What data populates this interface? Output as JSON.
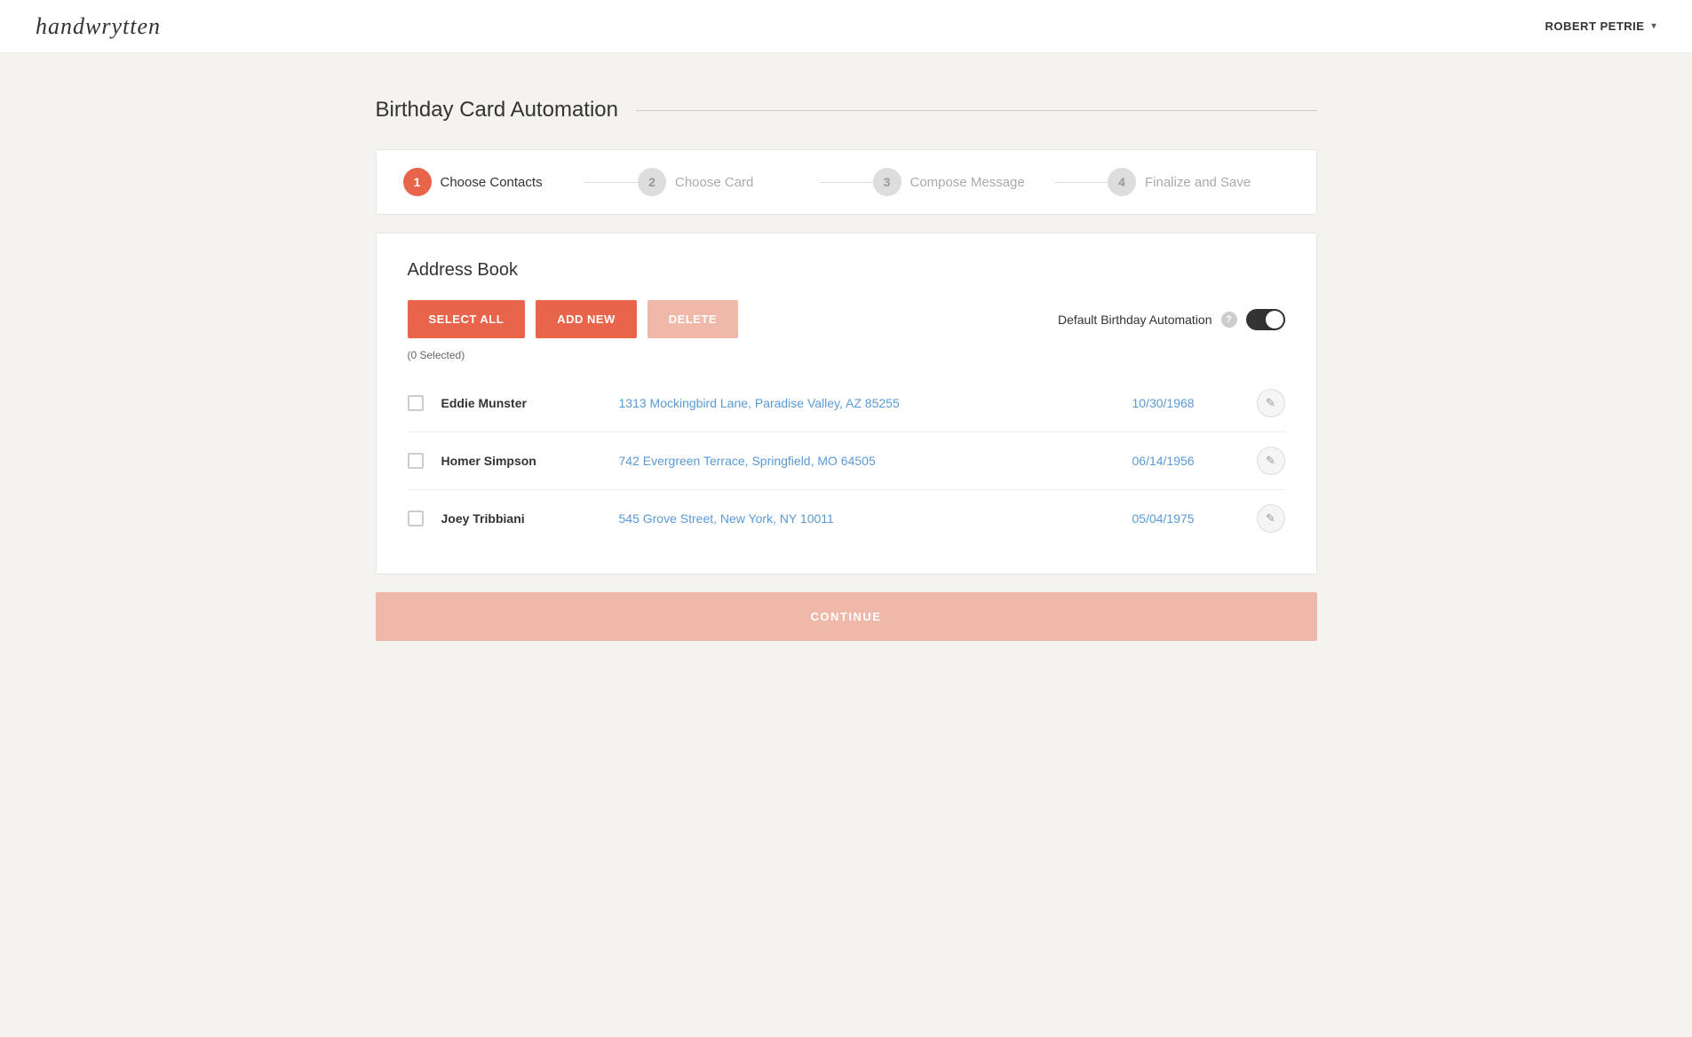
{
  "header": {
    "logo": "handwrytten",
    "user_name": "ROBERT PETRIE",
    "chevron": "▾"
  },
  "page": {
    "title": "Birthday Card Automation"
  },
  "steps": [
    {
      "number": "1",
      "label": "Choose Contacts",
      "state": "active"
    },
    {
      "number": "2",
      "label": "Choose Card",
      "state": "inactive"
    },
    {
      "number": "3",
      "label": "Compose Message",
      "state": "inactive"
    },
    {
      "number": "4",
      "label": "Finalize and Save",
      "state": "inactive"
    }
  ],
  "address_book": {
    "title": "Address Book",
    "select_all_label": "SELECT ALL",
    "add_new_label": "ADD NEW",
    "delete_label": "DELETE",
    "default_birthday_label": "Default Birthday Automation",
    "help_icon": "?",
    "selected_count": "(0 Selected)",
    "contacts": [
      {
        "name": "Eddie Munster",
        "address": "1313 Mockingbird Lane, Paradise Valley, AZ 85255",
        "dob": "10/30/1968"
      },
      {
        "name": "Homer Simpson",
        "address": "742 Evergreen Terrace, Springfield, MO 64505",
        "dob": "06/14/1956"
      },
      {
        "name": "Joey Tribbiani",
        "address": "545 Grove Street, New York, NY 10011",
        "dob": "05/04/1975"
      }
    ],
    "continue_label": "CONTINUE"
  },
  "colors": {
    "primary": "#e8644a",
    "disabled": "#f0b8a8",
    "toggle_on": "#333333",
    "link_blue": "#5a9ad4"
  }
}
